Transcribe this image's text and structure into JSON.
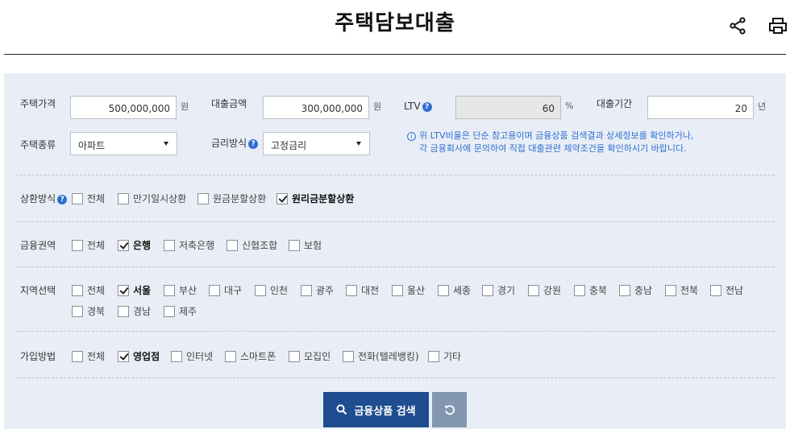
{
  "header": {
    "title": "주택담보대출",
    "share_icon": "share-icon",
    "print_icon": "print-icon"
  },
  "form": {
    "house_price": {
      "label": "주택가격",
      "value": "500,000,000",
      "unit": "원"
    },
    "loan_amount": {
      "label": "대출금액",
      "value": "300,000,000",
      "unit": "원"
    },
    "ltv": {
      "label": "LTV",
      "value": "60",
      "unit": "%"
    },
    "loan_period": {
      "label": "대출기간",
      "value": "20",
      "unit": "년"
    },
    "house_type": {
      "label": "주택종류",
      "value": "아파트"
    },
    "rate_type": {
      "label": "금리방식",
      "value": "고정금리"
    },
    "notice": {
      "line1": "위 LTV비율은 단순 참고용이며 금융상품 검색결과 상세정보를 확인하거나,",
      "line2": "각 금융회사에 문의하여 직접 대출관련 제약조건을 확인하시기 바랍니다."
    }
  },
  "filters": {
    "repayment": {
      "label": "상환방식",
      "options": [
        {
          "label": "전체",
          "checked": false
        },
        {
          "label": "만기일시상환",
          "checked": false
        },
        {
          "label": "원금분할상환",
          "checked": false
        },
        {
          "label": "원리금분할상환",
          "checked": true
        }
      ]
    },
    "sector": {
      "label": "금융권역",
      "options": [
        {
          "label": "전체",
          "checked": false
        },
        {
          "label": "은행",
          "checked": true
        },
        {
          "label": "저축은행",
          "checked": false
        },
        {
          "label": "신협조합",
          "checked": false
        },
        {
          "label": "보험",
          "checked": false
        }
      ]
    },
    "region": {
      "label": "지역선택",
      "options": [
        {
          "label": "전체",
          "checked": false
        },
        {
          "label": "서울",
          "checked": true
        },
        {
          "label": "부산",
          "checked": false
        },
        {
          "label": "대구",
          "checked": false
        },
        {
          "label": "인천",
          "checked": false
        },
        {
          "label": "광주",
          "checked": false
        },
        {
          "label": "대전",
          "checked": false
        },
        {
          "label": "울산",
          "checked": false
        },
        {
          "label": "세종",
          "checked": false
        },
        {
          "label": "경기",
          "checked": false
        },
        {
          "label": "강원",
          "checked": false
        },
        {
          "label": "충북",
          "checked": false
        },
        {
          "label": "충남",
          "checked": false
        },
        {
          "label": "전북",
          "checked": false
        },
        {
          "label": "전남",
          "checked": false
        },
        {
          "label": "경북",
          "checked": false
        },
        {
          "label": "경남",
          "checked": false
        },
        {
          "label": "제주",
          "checked": false
        }
      ]
    },
    "join": {
      "label": "가입방법",
      "options": [
        {
          "label": "전체",
          "checked": false
        },
        {
          "label": "영업점",
          "checked": true
        },
        {
          "label": "인터넷",
          "checked": false
        },
        {
          "label": "스마트폰",
          "checked": false
        },
        {
          "label": "모집인",
          "checked": false
        },
        {
          "label": "전화(텔레뱅킹)",
          "checked": false
        },
        {
          "label": "기타",
          "checked": false
        }
      ]
    }
  },
  "buttons": {
    "search_label": "금융상품 검색",
    "search_icon": "search-icon",
    "reset_icon": "reset-icon"
  }
}
